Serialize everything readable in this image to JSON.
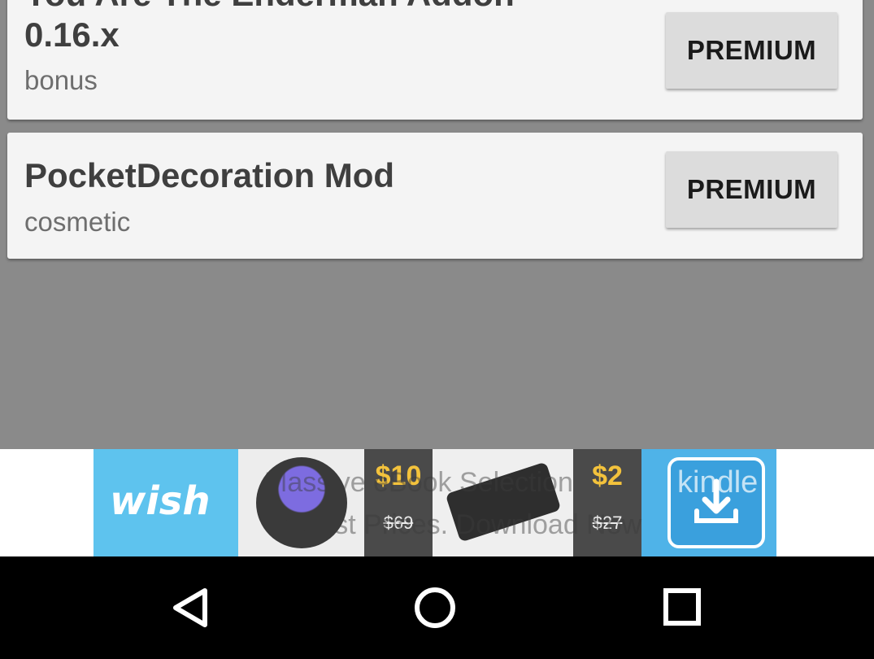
{
  "cards": [
    {
      "title_line1": "You Are The Enderman Addon",
      "title_line2": "0.16.x",
      "category": "bonus",
      "button_label": "PREMIUM"
    },
    {
      "title_line1": "PocketDecoration Mod",
      "category": "cosmetic",
      "button_label": "PREMIUM"
    }
  ],
  "ad": {
    "brand": "wish",
    "price1_new": "$10",
    "price1_old": "$69",
    "price2_new": "$2",
    "price2_old": "$27",
    "overlay_line1": "Massive eBook Selection",
    "overlay_line2": "Lowest Prices. Download Now",
    "overlay_brand": "kindle"
  },
  "navbar": {
    "icons": [
      "back-icon",
      "home-icon",
      "recents-icon"
    ]
  },
  "colors": {
    "background": "#8a8a8a",
    "card": "#f4f4f4",
    "button": "#dcdcdc",
    "navbar": "#000000"
  }
}
